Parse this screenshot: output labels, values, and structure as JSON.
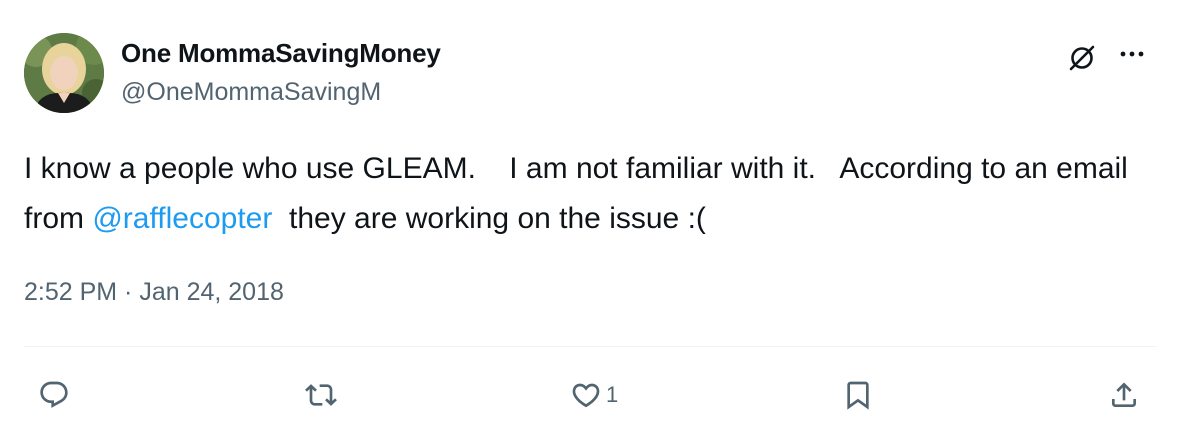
{
  "tweet": {
    "display_name": "One MommaSavingMoney",
    "handle": "@OneMommaSavingM",
    "text_before": "I know a people who use GLEAM.    I am not familiar with it.   According to an email from ",
    "mention": "@rafflecopter",
    "text_after": "  they are working on the issue :(",
    "timestamp": "2:52 PM · Jan 24, 2018"
  },
  "actions": {
    "reply_icon": "reply-icon",
    "retweet_icon": "retweet-icon",
    "like_icon": "heart-icon",
    "like_count": "1",
    "bookmark_icon": "bookmark-icon",
    "share_icon": "share-icon"
  },
  "header_icons": {
    "grok": "grok-icon",
    "more": "more-icon"
  },
  "colors": {
    "text": "#0f1419",
    "secondary": "#536471",
    "link": "#1d9bf0",
    "divider": "#eff3f4"
  }
}
